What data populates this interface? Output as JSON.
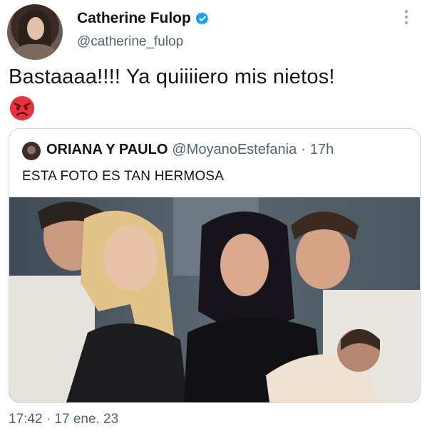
{
  "author": {
    "name": "Catherine Fulop",
    "handle": "@catherine_fulop"
  },
  "tweet": {
    "text": "Bastaaaa!!!! Ya quiiiiero mis nietos!",
    "emoji": "angry-face-emoji"
  },
  "quoted": {
    "name": "ORIANA Y PAULO",
    "handle": "@MoyanoEstefania",
    "separator": "·",
    "time": "17h",
    "text": "ESTA FOTO ES TAN HERMOSA"
  },
  "timestamp": "17:42 · 17 ene. 23",
  "colors": {
    "verified": "#1d9bf0",
    "secondary_text": "#536471",
    "border": "#cfd9de",
    "emoji_red": "#e8323b"
  }
}
